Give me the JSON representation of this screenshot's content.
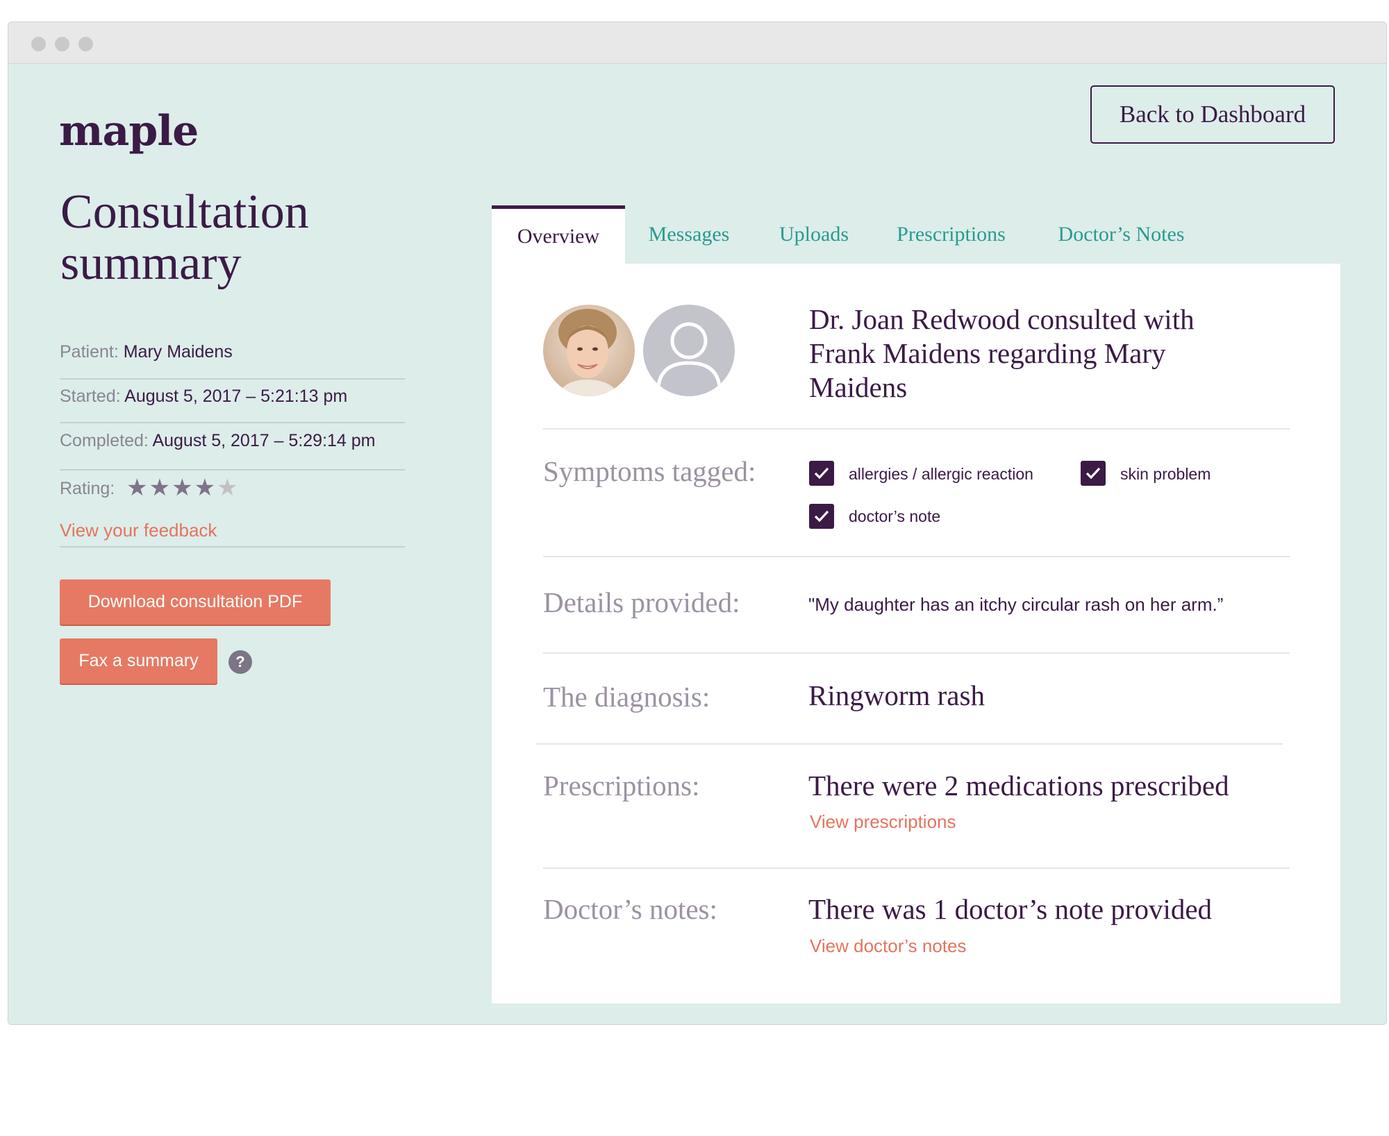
{
  "app": {
    "logo": "maple"
  },
  "header": {
    "back_label": "Back to Dashboard"
  },
  "sidebar": {
    "title": "Consultation summary",
    "patient_label": "Patient:",
    "patient_value": "Mary Maidens",
    "started_label": "Started:",
    "started_value": "August 5, 2017 – 5:21:13 pm",
    "completed_label": "Completed:",
    "completed_value": "August 5, 2017 – 5:29:14 pm",
    "rating_label": "Rating:",
    "rating": {
      "value": 4,
      "max": 5
    },
    "feedback_link": "View your feedback",
    "download_label": "Download consultation PDF",
    "fax_label": "Fax a summary",
    "help_glyph": "?"
  },
  "tabs": [
    {
      "label": "Overview",
      "active": true
    },
    {
      "label": "Messages",
      "active": false
    },
    {
      "label": "Uploads",
      "active": false
    },
    {
      "label": "Prescriptions",
      "active": false
    },
    {
      "label": "Doctor’s Notes",
      "active": false
    }
  ],
  "overview": {
    "summary": "Dr. Joan Redwood consulted with Frank Maidens regarding Mary Maidens",
    "avatars": [
      "doctor-photo",
      "user-placeholder-icon"
    ],
    "symptoms_label": "Symptoms tagged:",
    "symptoms": [
      "allergies / allergic reaction",
      "skin problem",
      "doctor’s note"
    ],
    "details_label": "Details provided:",
    "details_value": "\"My daughter has an itchy circular rash on her arm.”",
    "diagnosis_label": "The diagnosis:",
    "diagnosis_value": "Ringworm rash",
    "prescriptions_label": "Prescriptions:",
    "prescriptions_value": "There were 2 medications prescribed",
    "prescriptions_link": "View prescriptions",
    "notes_label": "Doctor’s notes:",
    "notes_value": "There was 1 doctor’s note provided",
    "notes_link": "View doctor’s notes"
  },
  "colors": {
    "brand": "#3b1b45",
    "accent": "#e67963",
    "tab_link": "#2a9a8e",
    "background": "#dcedea"
  }
}
